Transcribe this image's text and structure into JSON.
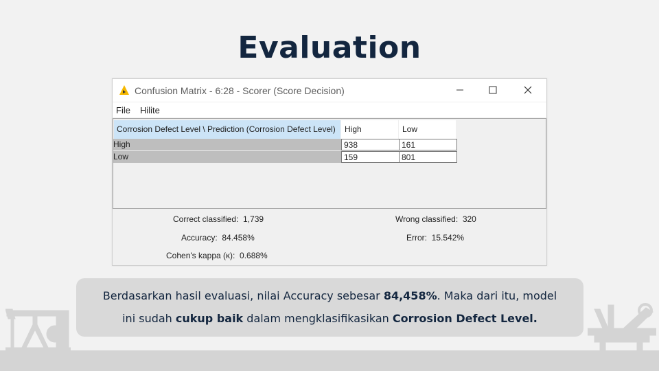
{
  "slide": {
    "title": "Evaluation"
  },
  "window": {
    "title": "Confusion Matrix - 6:28 - Scorer (Score Decision)",
    "menu": [
      "File",
      "Hilite"
    ]
  },
  "matrix": {
    "corner_header": "Corrosion Defect Level \\ Prediction (Corrosion Defect Level)",
    "col_headers": [
      "High",
      "Low"
    ],
    "rows": [
      {
        "label": "High",
        "values": [
          "938",
          "161"
        ]
      },
      {
        "label": "Low",
        "values": [
          "159",
          "801"
        ]
      }
    ]
  },
  "stats": {
    "correct_label": "Correct classified:",
    "correct_value": "1,739",
    "wrong_label": "Wrong classified:",
    "wrong_value": "320",
    "accuracy_label": "Accuracy:",
    "accuracy_value": "84.458%",
    "error_label": "Error:",
    "error_value": "15.542%",
    "kappa_label": "Cohen's kappa (κ):",
    "kappa_value": "0.688%"
  },
  "caption": {
    "line1_pre": "Berdasarkan hasil evaluasi, nilai Accuracy sebesar ",
    "line1_bold": "84,458%",
    "line1_post": ". Maka dari itu, model",
    "line2_pre": "ini sudah ",
    "line2_bold1": "cukup baik",
    "line2_mid": " dalam mengklasifikasikan ",
    "line2_bold2": "Corrosion Defect Level."
  },
  "icons": {
    "app": "knime-scorer-icon",
    "minimize": "minimize-icon",
    "maximize": "maximize-icon",
    "close": "close-icon",
    "left_decor": "oil-pumpjack-icon",
    "right_decor": "offshore-rig-icon"
  },
  "colors": {
    "title": "#13263f",
    "header_highlight": "#cce4f7",
    "row_header": "#bebebe",
    "app_icon": "#f5b800"
  }
}
